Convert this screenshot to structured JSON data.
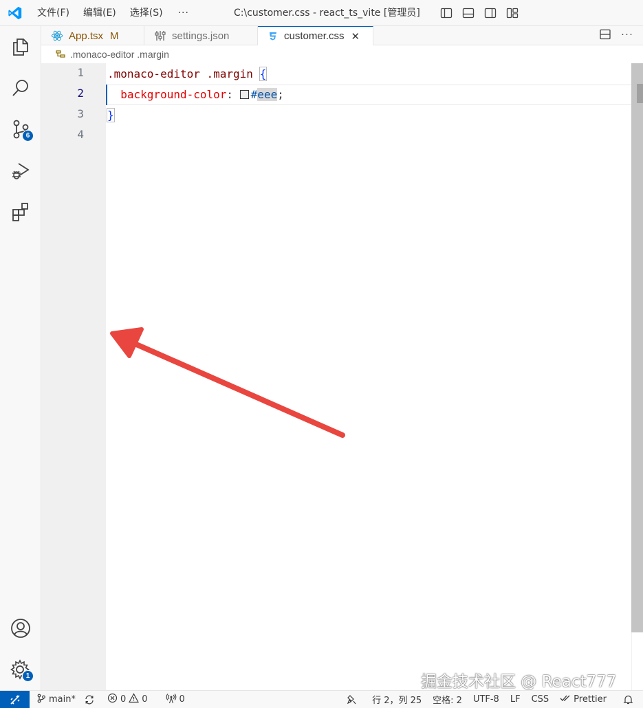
{
  "menu": {
    "file": "文件(F)",
    "edit": "编辑(E)",
    "selection": "选择(S)",
    "more": "···"
  },
  "window_title": "C:\\customer.css - react_ts_vite [管理员]",
  "activity": {
    "source_control_badge": "6",
    "settings_badge": "1"
  },
  "tabs": [
    {
      "label": "App.tsx",
      "modified": "M"
    },
    {
      "label": "settings.json"
    },
    {
      "label": "customer.css",
      "close": "✕"
    }
  ],
  "tab_actions": {
    "more": "···"
  },
  "breadcrumb": ".monaco-editor .margin",
  "editor": {
    "line_numbers": [
      "1",
      "2",
      "3",
      "4"
    ],
    "line1": {
      "selector": ".monaco-editor .margin",
      "space": " ",
      "open": "{"
    },
    "line2": {
      "indent": "  ",
      "property": "background-color",
      "colon": ": ",
      "hash": "#",
      "value": "eee",
      "semi": ";"
    },
    "line3": {
      "close": "}"
    }
  },
  "watermark": "掘金技术社区 @ React777",
  "status": {
    "branch": "main*",
    "errors": "0",
    "warnings": "0",
    "ports": "0",
    "position": "行 2，列 25",
    "spaces": "空格: 2",
    "encoding": "UTF-8",
    "eol": "LF",
    "language": "CSS",
    "formatter": "Prettier"
  },
  "colors": {
    "accent": "#005fb8",
    "arrow": "#e9463f",
    "gutter_bg": "#f0f0f0"
  }
}
